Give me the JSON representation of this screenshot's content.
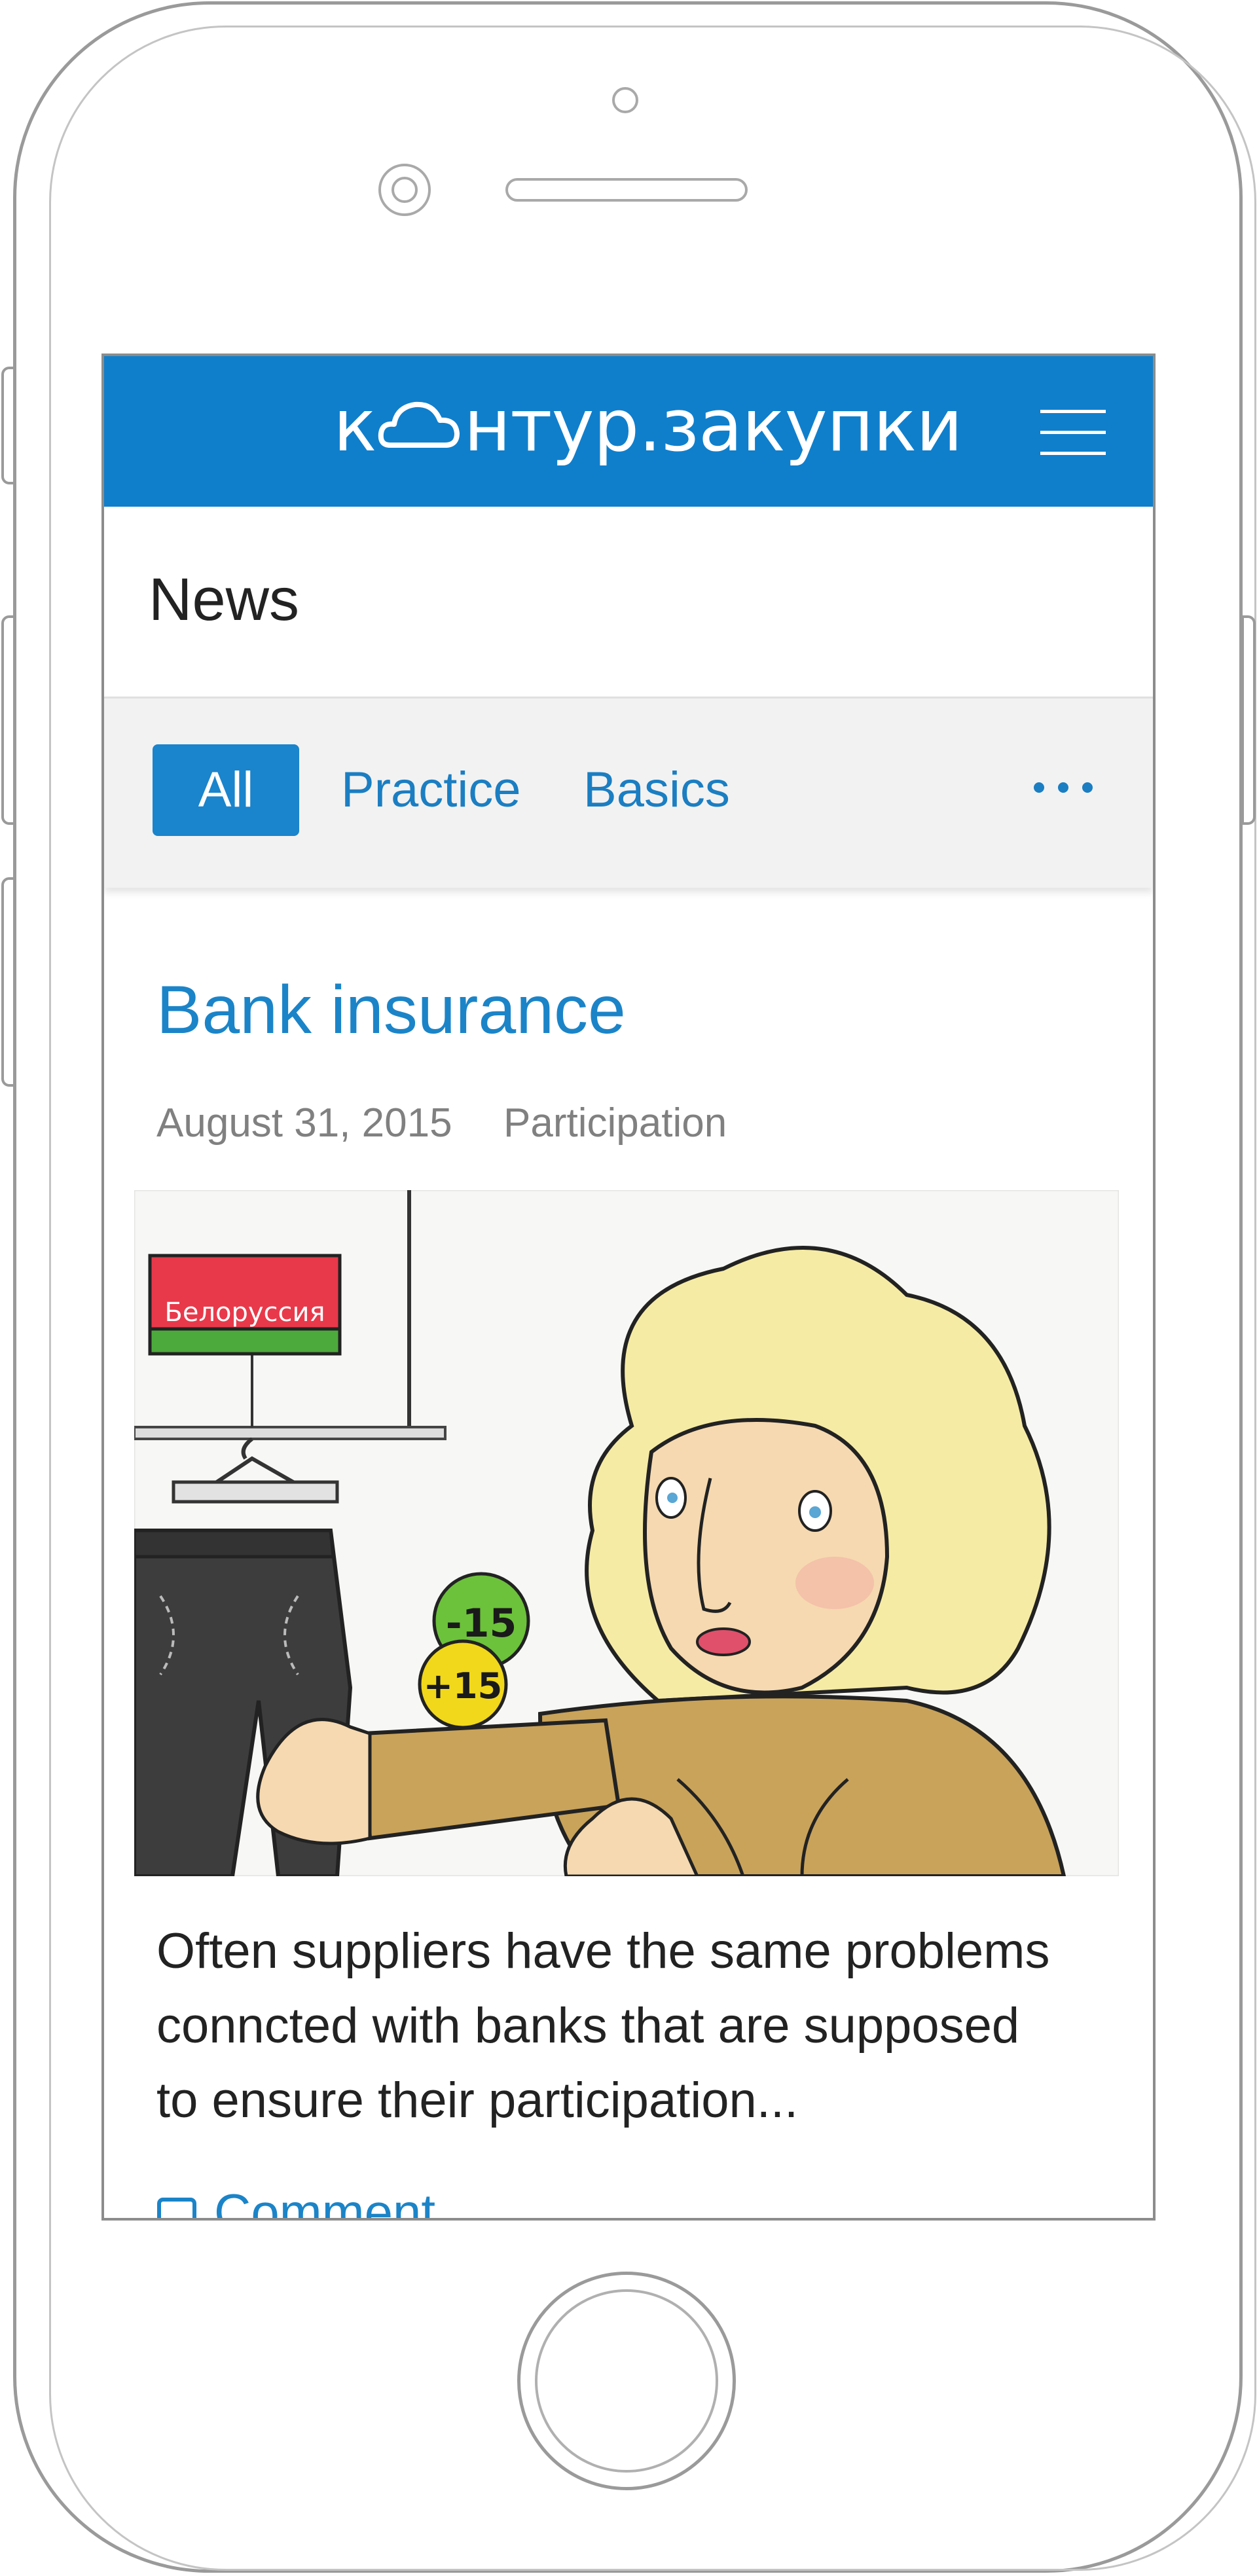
{
  "header": {
    "logo_text": "к",
    "logo_text_rest": "нтур.закупки",
    "background": "#0f7fcc"
  },
  "page": {
    "title": "News"
  },
  "tabs": {
    "items": [
      {
        "label": "All",
        "active": true
      },
      {
        "label": "Practice",
        "active": false
      },
      {
        "label": "Basics",
        "active": false
      }
    ],
    "more_icon": "more-dots-icon"
  },
  "article": {
    "title": "Bank insurance",
    "date": "August 31, 2015",
    "category": "Participation",
    "illustration": {
      "sign_text": "Белоруссия",
      "tag_green": "-15",
      "tag_yellow": "+15"
    },
    "excerpt_lines": [
      "Often suppliers have the same problems",
      "conncted with banks that are supposed",
      "to ensure their participation..."
    ],
    "comment_label": "Comment"
  },
  "colors": {
    "accent": "#1b84c8",
    "tab_active_bg": "#1a84cc",
    "tab_bar_bg": "#f2f2f2"
  }
}
